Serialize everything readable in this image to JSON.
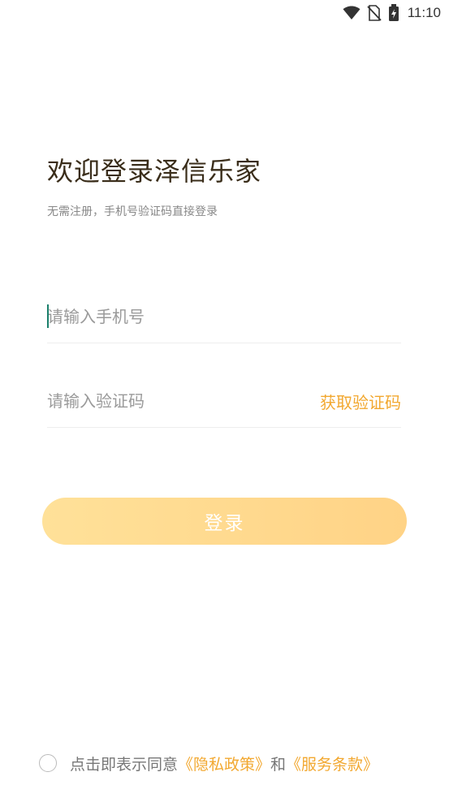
{
  "status_bar": {
    "time": "11:10",
    "icons": [
      "wifi-icon",
      "no-sim-icon",
      "battery-charging-icon"
    ]
  },
  "welcome": {
    "title": "欢迎登录泽信乐家",
    "subtitle": "无需注册，手机号验证码直接登录"
  },
  "phone_field": {
    "placeholder": "请输入手机号",
    "value": ""
  },
  "code_field": {
    "placeholder": "请输入验证码",
    "value": "",
    "get_code_label": "获取验证码"
  },
  "login_button": {
    "label": "登录"
  },
  "agreement": {
    "checked": false,
    "prefix": "点击即表示同意",
    "privacy_link": "《隐私政策》",
    "and": "和",
    "terms_link": "《服务条款》"
  },
  "colors": {
    "accent": "#f2a830",
    "button_gradient_start": "#ffe199",
    "button_gradient_end": "#ffd386",
    "title": "#3a2d1a",
    "cursor": "#1a7f6b"
  }
}
